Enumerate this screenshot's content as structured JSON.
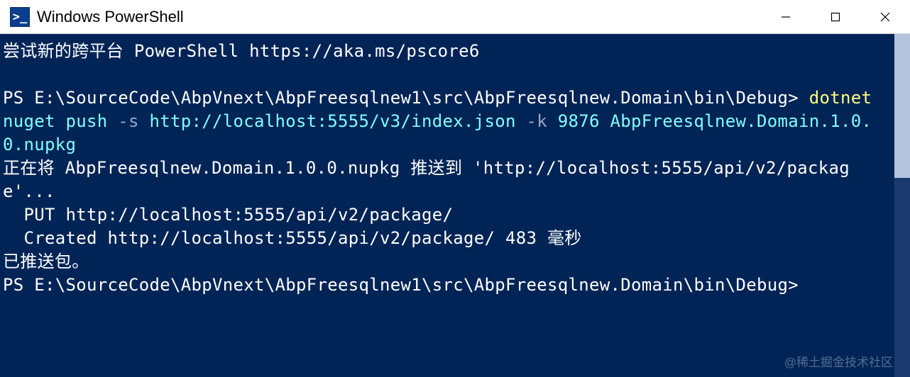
{
  "titlebar": {
    "icon_glyph": ">_",
    "title": "Windows PowerShell"
  },
  "terminal": {
    "line1": "尝试新的跨平台 PowerShell https://aka.ms/pscore6",
    "blank1": " ",
    "prompt1_prefix": "PS ",
    "prompt1_path": "E:\\SourceCode\\AbpVnext\\AbpFreesqlnew1\\src\\AbpFreesqlnew.Domain\\bin\\Debug",
    "prompt1_suffix": "> ",
    "cmd1a": "dotnet ",
    "cmd1b": "nuget push ",
    "cmd1c": "-s ",
    "cmd1d": "http://localhost:5555/v3/index.json ",
    "cmd1e": "-k ",
    "cmd1f": "9876 ",
    "cmd1g": "AbpFreesqlnew.Domain.1.0.0.nupkg",
    "out1": "正在将 AbpFreesqlnew.Domain.1.0.0.nupkg 推送到 'http://localhost:5555/api/v2/package'...",
    "out2": "  PUT http://localhost:5555/api/v2/package/",
    "out3": "  Created http://localhost:5555/api/v2/package/ 483 毫秒",
    "out4": "已推送包。",
    "prompt2_prefix": "PS ",
    "prompt2_path": "E:\\SourceCode\\AbpVnext\\AbpFreesqlnew1\\src\\AbpFreesqlnew.Domain\\bin\\Debug",
    "prompt2_suffix": ">"
  },
  "watermark": "@稀土掘金技术社区",
  "colors": {
    "background": "#012456",
    "text": "#ffffff",
    "command": "#ffff80",
    "string": "#80ffff",
    "dim": "#98a8c8"
  }
}
